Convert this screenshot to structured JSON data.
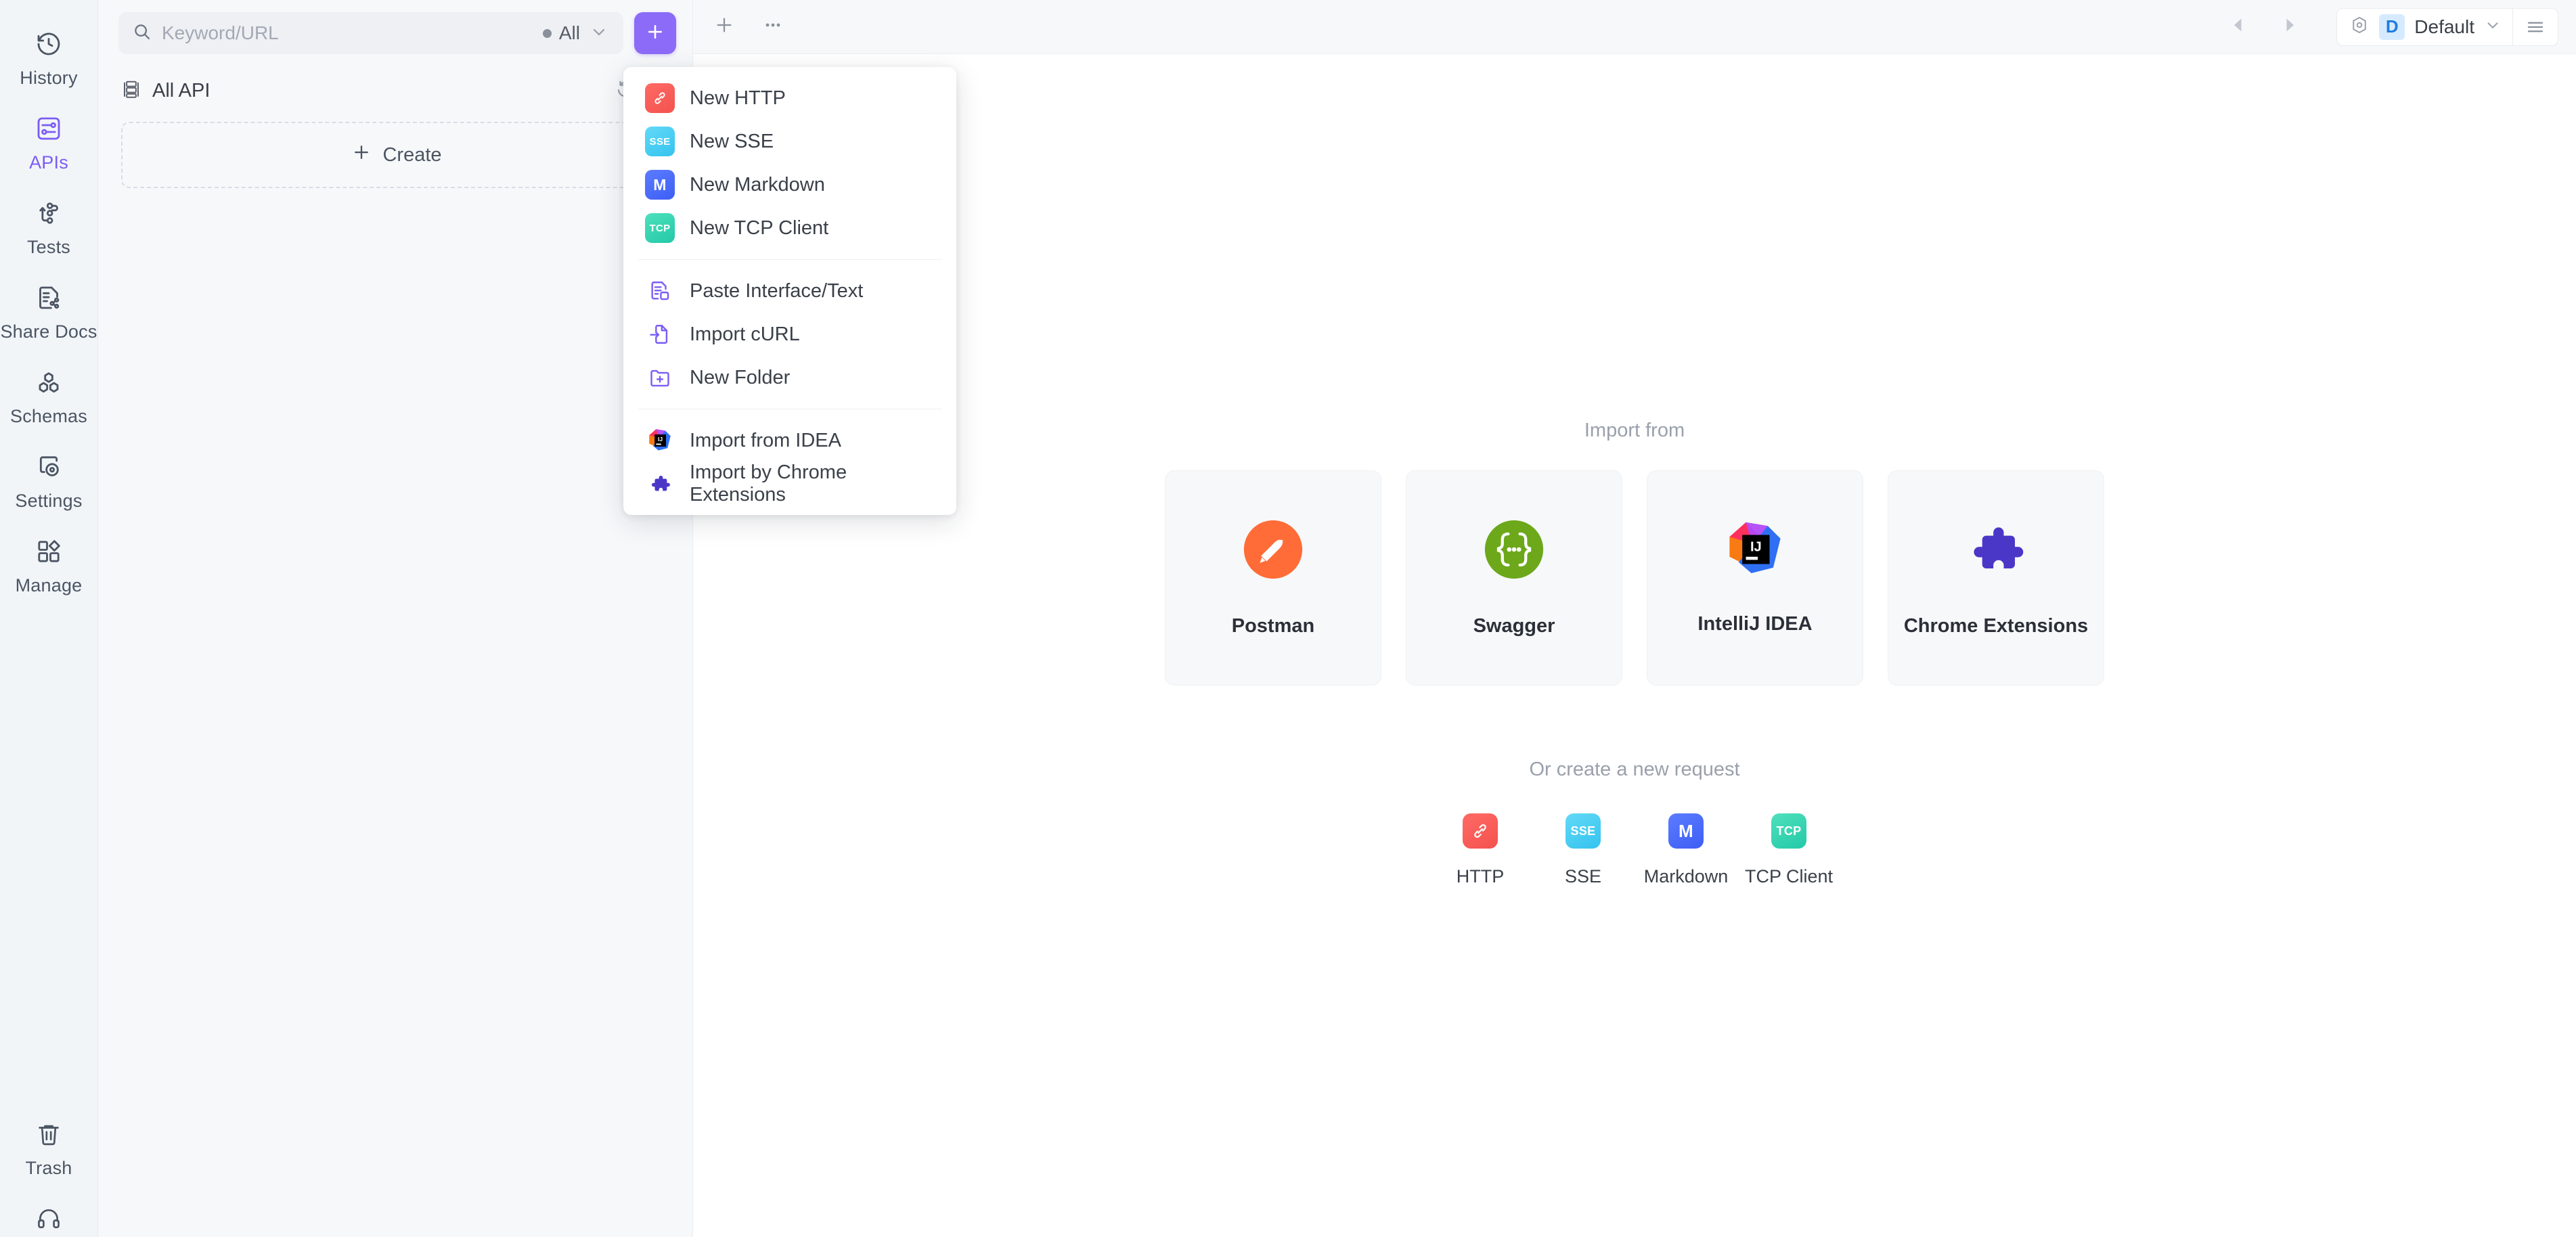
{
  "colors": {
    "accent": "#7b5cf5",
    "add_button": "#8b6bf7",
    "panel_bg": "#f7f8fa",
    "rail_bg": "#f2f5f8",
    "env_badge_bg": "#d6eaff",
    "env_badge_fg": "#1f7ae0"
  },
  "rail": {
    "items": [
      {
        "label": "History",
        "icon": "history-icon",
        "active": false
      },
      {
        "label": "APIs",
        "icon": "apis-sliders-icon",
        "active": true
      },
      {
        "label": "Tests",
        "icon": "tests-flow-icon",
        "active": false
      },
      {
        "label": "Share Docs",
        "icon": "share-docs-icon",
        "active": false
      },
      {
        "label": "Schemas",
        "icon": "schemas-hex-icon",
        "active": false
      },
      {
        "label": "Settings",
        "icon": "settings-eye-icon",
        "active": false
      },
      {
        "label": "Manage",
        "icon": "manage-grid-icon",
        "active": false
      }
    ],
    "bottom_items": [
      {
        "label": "Trash",
        "icon": "trash-icon"
      },
      {
        "label": "",
        "icon": "headset-support-icon"
      }
    ]
  },
  "panel": {
    "search": {
      "placeholder": "Keyword/URL",
      "value": "",
      "scope_label": "All",
      "icon": "search-icon",
      "chevron": "chevron-down-icon"
    },
    "add_button": {
      "label": "+",
      "icon": "plus-icon"
    },
    "header": {
      "title": "All API",
      "icon": "api-list-icon",
      "refresh_icon": "refresh-icon",
      "collapse_icon": "collapse-icon"
    },
    "create_button": {
      "label": "Create",
      "icon": "plus-icon"
    }
  },
  "menu": {
    "groups": [
      {
        "items": [
          {
            "label": "New HTTP",
            "icon": "http-tile-icon",
            "tile": "http",
            "glyph": "⚭"
          },
          {
            "label": "New SSE",
            "icon": "sse-tile-icon",
            "tile": "sse",
            "glyph": "SSE"
          },
          {
            "label": "New Markdown",
            "icon": "markdown-tile-icon",
            "tile": "md",
            "glyph": "M"
          },
          {
            "label": "New TCP Client",
            "icon": "tcp-tile-icon",
            "tile": "tcp",
            "glyph": "TCP"
          }
        ]
      },
      {
        "items": [
          {
            "label": "Paste Interface/Text",
            "icon": "paste-interface-icon",
            "tile": "outline"
          },
          {
            "label": "Import cURL",
            "icon": "import-curl-icon",
            "tile": "outline"
          },
          {
            "label": "New Folder",
            "icon": "new-folder-icon",
            "tile": "outline"
          }
        ]
      },
      {
        "items": [
          {
            "label": "Import from IDEA",
            "icon": "intellij-idea-icon",
            "tile": "brand"
          },
          {
            "label": "Import by Chrome Extensions",
            "icon": "chrome-extension-puzzle-icon",
            "tile": "brand"
          }
        ]
      }
    ]
  },
  "main": {
    "toolbar": {
      "new_tab_icon": "plus-icon",
      "more_icon": "ellipsis-icon",
      "back_icon": "caret-left-icon",
      "forward_icon": "caret-right-icon",
      "env_gear_icon": "environment-gear-icon",
      "env_badge": "D",
      "env_name": "Default",
      "env_chevron": "chevron-down-icon",
      "menu_icon": "hamburger-menu-icon"
    },
    "import_section": {
      "title": "Import from",
      "cards": [
        {
          "label": "Postman",
          "icon": "postman-icon"
        },
        {
          "label": "Swagger",
          "icon": "swagger-icon"
        },
        {
          "label": "IntelliJ IDEA",
          "icon": "intellij-idea-icon"
        },
        {
          "label": "Chrome Extensions",
          "icon": "chrome-extension-puzzle-icon"
        }
      ]
    },
    "create_section": {
      "title": "Or create a new request",
      "items": [
        {
          "label": "HTTP",
          "icon": "http-tile-icon",
          "tile": "http",
          "glyph": "⚭"
        },
        {
          "label": "SSE",
          "icon": "sse-tile-icon",
          "tile": "sse",
          "glyph": "SSE"
        },
        {
          "label": "Markdown",
          "icon": "markdown-tile-icon",
          "tile": "md",
          "glyph": "M"
        },
        {
          "label": "TCP Client",
          "icon": "tcp-tile-icon",
          "tile": "tcp",
          "glyph": "TCP"
        }
      ]
    }
  }
}
